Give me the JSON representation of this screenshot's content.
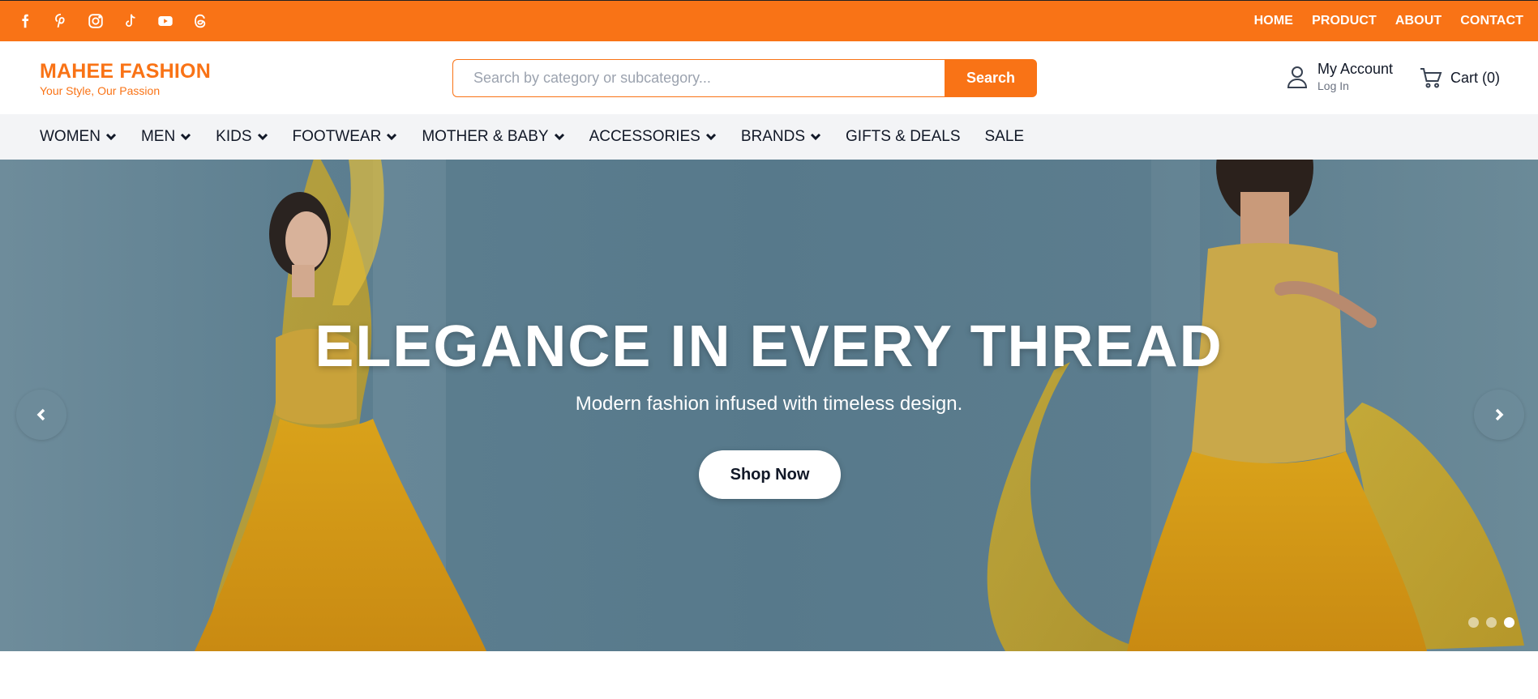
{
  "social": {
    "icons": [
      "facebook-icon",
      "pinterest-icon",
      "instagram-icon",
      "tiktok-icon",
      "youtube-icon",
      "threads-icon"
    ]
  },
  "topnav": {
    "links": [
      "HOME",
      "PRODUCT",
      "ABOUT",
      "CONTACT"
    ]
  },
  "brand": {
    "name": "MAHEE FASHION",
    "tagline": "Your Style, Our Passion",
    "accent_color": "#f97316"
  },
  "search": {
    "placeholder": "Search by category or subcategory...",
    "value": "",
    "button_label": "Search"
  },
  "account": {
    "title": "My Account",
    "subtitle": "Log In"
  },
  "cart": {
    "label": "Cart (0)"
  },
  "nav": {
    "items": [
      {
        "label": "WOMEN",
        "dropdown": true
      },
      {
        "label": "MEN",
        "dropdown": true
      },
      {
        "label": "KIDS",
        "dropdown": true
      },
      {
        "label": "FOOTWEAR",
        "dropdown": true
      },
      {
        "label": "MOTHER & BABY",
        "dropdown": true
      },
      {
        "label": "ACCESSORIES",
        "dropdown": true
      },
      {
        "label": "BRANDS",
        "dropdown": true
      },
      {
        "label": "GIFTS & DEALS",
        "dropdown": false
      },
      {
        "label": "SALE",
        "dropdown": false
      }
    ]
  },
  "hero": {
    "headline": "ELEGANCE IN EVERY THREAD",
    "subtitle": "Modern fashion infused with timeless design.",
    "cta_label": "Shop Now",
    "slides": 3,
    "active_slide": 3
  }
}
